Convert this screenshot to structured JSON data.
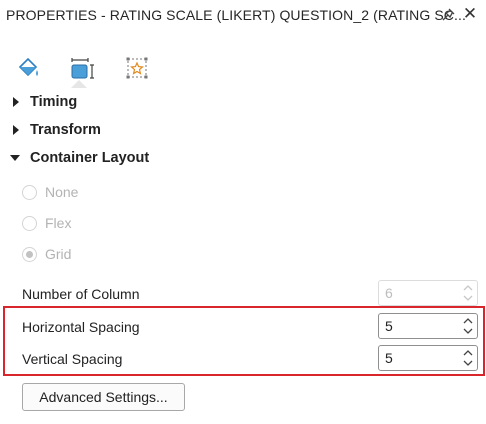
{
  "panel": {
    "title": "PROPERTIES - RATING SCALE (LIKERT) QUESTION_2 (RATING SC...",
    "pin_icon": "pin-icon",
    "close_icon": "close-icon"
  },
  "tabs": [
    {
      "name": "fill-tab",
      "icon": "paint-bucket-icon",
      "active": false
    },
    {
      "name": "layout-tab",
      "icon": "layout-size-icon",
      "active": true
    },
    {
      "name": "effects-tab",
      "icon": "star-frame-icon",
      "active": false
    }
  ],
  "sections": {
    "timing": {
      "label": "Timing",
      "expanded": false
    },
    "transform": {
      "label": "Transform",
      "expanded": false
    },
    "container_layout": {
      "label": "Container Layout",
      "expanded": true
    }
  },
  "layout_options": [
    {
      "label": "None",
      "selected": false
    },
    {
      "label": "Flex",
      "selected": false
    },
    {
      "label": "Grid",
      "selected": true
    }
  ],
  "properties": {
    "number_of_column": {
      "label": "Number of Column",
      "value": "6",
      "enabled": false
    },
    "horizontal_spacing": {
      "label": "Horizontal Spacing",
      "value": "5",
      "enabled": true
    },
    "vertical_spacing": {
      "label": "Vertical Spacing",
      "value": "5",
      "enabled": true
    }
  },
  "advanced_button": {
    "label": "Advanced Settings..."
  },
  "colors": {
    "highlight": "#d9262c",
    "accent": "#4a9fd8"
  }
}
